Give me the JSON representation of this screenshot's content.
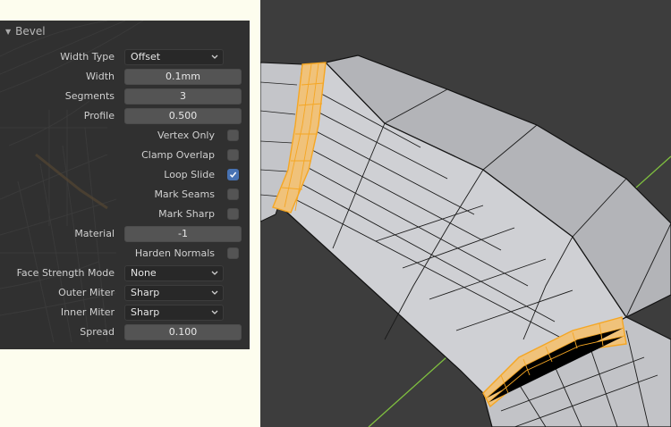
{
  "panel": {
    "title": "Bevel",
    "width_type": {
      "label": "Width Type",
      "value": "Offset"
    },
    "width": {
      "label": "Width",
      "value": "0.1mm"
    },
    "segments": {
      "label": "Segments",
      "value": "3"
    },
    "profile": {
      "label": "Profile",
      "value": "0.500"
    },
    "vertex_only": {
      "label": "Vertex Only",
      "checked": false
    },
    "clamp_overlap": {
      "label": "Clamp Overlap",
      "checked": false
    },
    "loop_slide": {
      "label": "Loop Slide",
      "checked": true
    },
    "mark_seams": {
      "label": "Mark Seams",
      "checked": false
    },
    "mark_sharp": {
      "label": "Mark Sharp",
      "checked": false
    },
    "material": {
      "label": "Material",
      "value": "-1"
    },
    "harden_normals": {
      "label": "Harden Normals",
      "checked": false
    },
    "face_strength": {
      "label": "Face Strength Mode",
      "value": "None"
    },
    "outer_miter": {
      "label": "Outer Miter",
      "value": "Sharp"
    },
    "inner_miter": {
      "label": "Inner Miter",
      "value": "Sharp"
    },
    "spread": {
      "label": "Spread",
      "value": "0.100"
    }
  },
  "colors": {
    "panel_bg": "#303030",
    "mesh_face": "#cfd0d4",
    "mesh_edge": "#111111",
    "selection": "#f5a623",
    "checkbox_on": "#4772b3",
    "y_axis": "#7fbf3f",
    "viewport_bg": "#3d3d3d"
  },
  "icons": [
    "disclosure-triangle-icon",
    "chevron-down-icon",
    "checkmark-icon"
  ]
}
